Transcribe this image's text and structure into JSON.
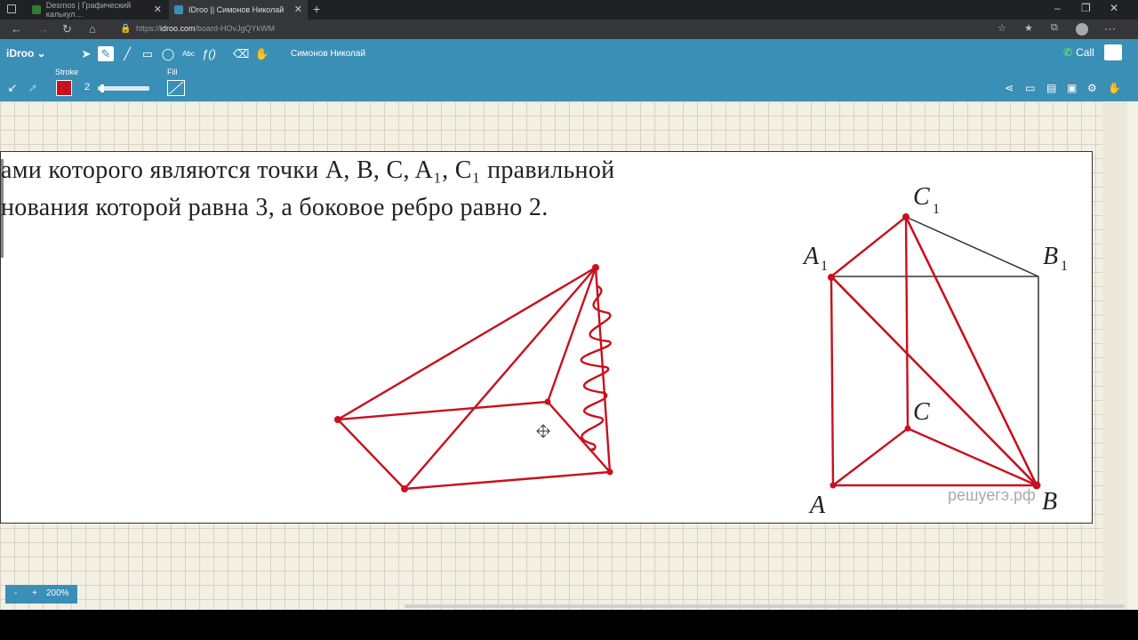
{
  "browser": {
    "tabs": [
      {
        "title": "Desmos | Графический калькул…",
        "active": false,
        "favicon_color": "#2e7d32"
      },
      {
        "title": "IDroo || Симонов Николай",
        "active": true,
        "favicon_color": "#3a8fb6"
      }
    ],
    "url_prefix": "https://",
    "url_host": "idroo.com",
    "url_path": "/board-HOvJgQYkWM"
  },
  "app": {
    "logo": "iDroo",
    "user_name": "Симонов Николай",
    "call_label": "Call",
    "stroke_label": "Stroke",
    "fill_label": "Fill",
    "stroke_width": "2",
    "stroke_color": "#c8101e",
    "stroke_width_level": 0.05
  },
  "document": {
    "line1": "ами которого являются точки A, B, C, A₁, C₁ правильной",
    "line2": "нования которой равна 3, а боковое ребро равно 2.",
    "labels": {
      "C1": "C",
      "A1": "A",
      "B1": "B",
      "C": "C",
      "A": "A",
      "B": "B",
      "sub": "1"
    },
    "watermark": "решуегэ.рф"
  },
  "zoom": {
    "minus": "-",
    "plus": "+",
    "level": "200%"
  },
  "colors": {
    "toolbar": "#3a8fb6",
    "ink": "#c8101e"
  }
}
